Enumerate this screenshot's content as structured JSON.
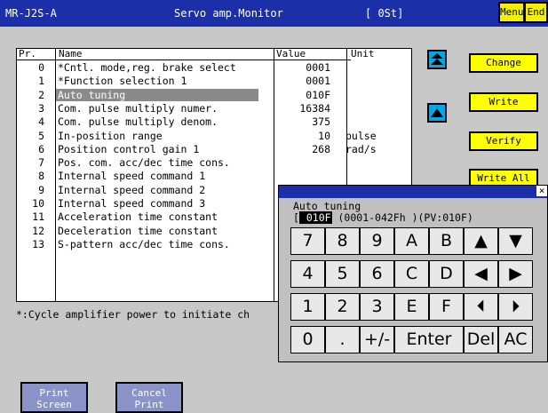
{
  "header": {
    "model": "MR-J2S-A",
    "title": "Servo amp.Monitor",
    "status": "[ 0St]",
    "menu_label": "Menu",
    "end_label": "End"
  },
  "table": {
    "columns": {
      "pr": "Pr.",
      "name": "Name",
      "value": "Value",
      "unit": "Unit"
    },
    "rows": [
      {
        "no": "0",
        "name": "*Cntl. mode,reg. brake select",
        "value": "0001",
        "unit": ""
      },
      {
        "no": "1",
        "name": "*Function selection 1",
        "value": "0001",
        "unit": ""
      },
      {
        "no": "2",
        "name": "Auto tuning",
        "value": "010F",
        "unit": ""
      },
      {
        "no": "3",
        "name": "Com. pulse multiply numer.",
        "value": "16384",
        "unit": ""
      },
      {
        "no": "4",
        "name": "Com. pulse multiply denom.",
        "value": "375",
        "unit": ""
      },
      {
        "no": "5",
        "name": "In-position range",
        "value": "10",
        "unit": "pulse"
      },
      {
        "no": "6",
        "name": "Position control gain 1",
        "value": "268",
        "unit": "rad/s"
      },
      {
        "no": "7",
        "name": "Pos. com. acc/dec time cons.",
        "value": "",
        "unit": ""
      },
      {
        "no": "8",
        "name": "Internal speed command 1",
        "value": "",
        "unit": ""
      },
      {
        "no": "9",
        "name": "Internal speed command 2",
        "value": "",
        "unit": ""
      },
      {
        "no": "10",
        "name": "Internal speed command 3",
        "value": "",
        "unit": ""
      },
      {
        "no": "11",
        "name": "Acceleration time constant",
        "value": "",
        "unit": ""
      },
      {
        "no": "12",
        "name": "Deceleration time constant",
        "value": "",
        "unit": ""
      },
      {
        "no": "13",
        "name": "S-pattern acc/dec time cons.",
        "value": "",
        "unit": ""
      }
    ]
  },
  "note": "*:Cycle amplifier power to initiate ch",
  "side_buttons": {
    "change": "Change",
    "write": "Write",
    "verify": "Verify",
    "write_all": "Write All"
  },
  "bottom_buttons": {
    "print_screen": [
      "Print",
      "Screen"
    ],
    "cancel_print": [
      "Cancel",
      "Print"
    ]
  },
  "keypad": {
    "label": "Auto tuning",
    "input_open": "[",
    "input_value": " 010F",
    "range": "(0001-042Fh  )(PV:010F)",
    "close": "×",
    "rows": [
      [
        "7",
        "8",
        "9",
        "A",
        "B",
        "▲",
        "▼"
      ],
      [
        "4",
        "5",
        "6",
        "C",
        "D",
        "◀",
        "▶"
      ],
      [
        "1",
        "2",
        "3",
        "E",
        "F",
        "⏴",
        "⏵"
      ],
      [
        "0",
        ".",
        "+/-",
        "Enter",
        "Del",
        "AC"
      ]
    ]
  },
  "colors": {
    "titlebar": "#1a2fa8",
    "accent_button": "#ffff00",
    "scroll_button": "#00a8e8",
    "background": "#c8c8c8"
  },
  "icons": {
    "scroll_top": "double-up-arrow-icon",
    "scroll_up": "up-arrow-icon"
  }
}
